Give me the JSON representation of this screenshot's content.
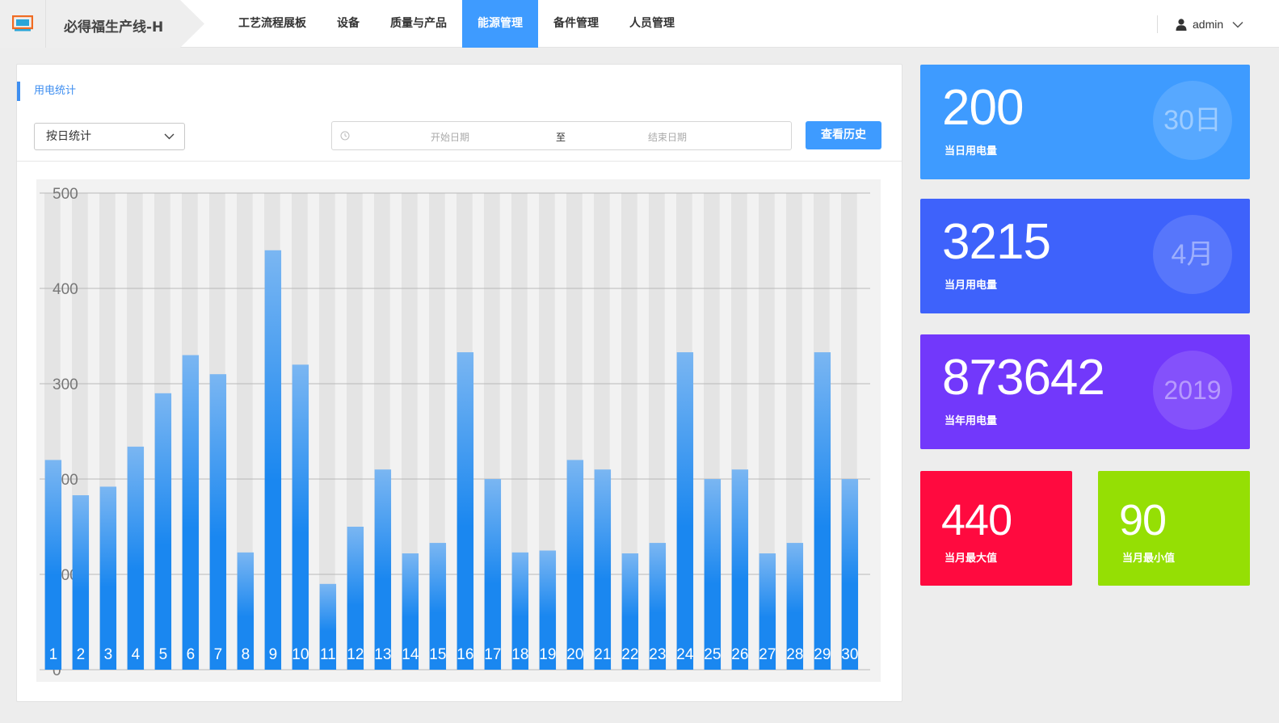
{
  "app": {
    "brand_title": "必得福生产线-H"
  },
  "nav": {
    "items": [
      {
        "label": "工艺流程展板",
        "active": false
      },
      {
        "label": "设备",
        "active": false
      },
      {
        "label": "质量与产品",
        "active": false
      },
      {
        "label": "能源管理",
        "active": true
      },
      {
        "label": "备件管理",
        "active": false
      },
      {
        "label": "人员管理",
        "active": false
      }
    ],
    "user_name": "admin"
  },
  "panel": {
    "title": "用电统计",
    "filter_selected": "按日统计",
    "date_start_placeholder": "开始日期",
    "date_separator": "至",
    "date_end_placeholder": "结束日期",
    "history_button": "查看历史"
  },
  "chart_data": {
    "type": "bar",
    "categories": [
      "1",
      "2",
      "3",
      "4",
      "5",
      "6",
      "7",
      "8",
      "9",
      "10",
      "11",
      "12",
      "13",
      "14",
      "15",
      "16",
      "17",
      "18",
      "19",
      "20",
      "21",
      "22",
      "23",
      "24",
      "25",
      "26",
      "27",
      "28",
      "29",
      "30"
    ],
    "values": [
      220,
      183,
      192,
      234,
      290,
      330,
      310,
      123,
      440,
      320,
      90,
      150,
      210,
      122,
      133,
      333,
      200,
      123,
      125,
      220,
      210,
      122,
      133,
      333,
      200,
      210,
      122,
      133,
      333,
      200
    ],
    "ylim": [
      0,
      500
    ],
    "y_ticks": [
      "0",
      "100",
      "200",
      "300",
      "400",
      "500"
    ],
    "grid": true,
    "bar_color": "#1a87f0"
  },
  "cards": [
    {
      "value": "200",
      "label": "当日用电量",
      "badge": "30日",
      "color": "#3e9bff"
    },
    {
      "value": "3215",
      "label": "当月用电量",
      "badge": "4月",
      "color": "#3e62fb"
    },
    {
      "value": "873642",
      "label": "当年用电量",
      "badge": "2019",
      "color": "#7238fb"
    },
    {
      "value": "440",
      "label": "当月最大值",
      "color": "#ff0a3f"
    },
    {
      "value": "90",
      "label": "当月最小值",
      "color": "#95df04"
    }
  ]
}
